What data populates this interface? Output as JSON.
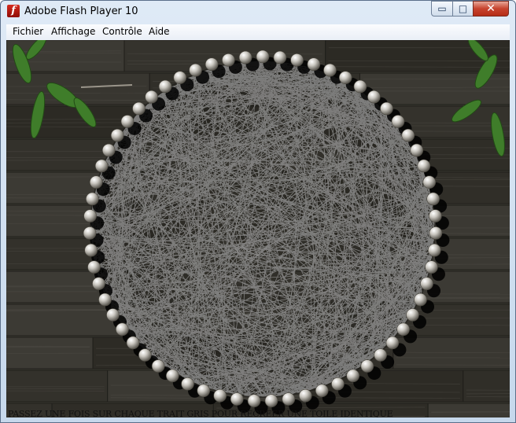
{
  "window": {
    "title": "Adobe Flash Player 10"
  },
  "title_controls": {
    "minimize": "▭",
    "maximize": "□",
    "close": "✕"
  },
  "menu": [
    {
      "label": "Fichier"
    },
    {
      "label": "Affichage"
    },
    {
      "label": "Contrôle"
    },
    {
      "label": "Aide"
    }
  ],
  "game": {
    "instruction": "PASSEZ UNE FOIS SUR CHAQUE TRAIT GRIS POUR RECREER UNE TOILE IDENTIQUE",
    "pin_count": 63,
    "thread_count": 900
  },
  "colors": {
    "wood": "#3b3a33",
    "thread": "#9a9a9a",
    "pin": "#e8e6e0"
  }
}
